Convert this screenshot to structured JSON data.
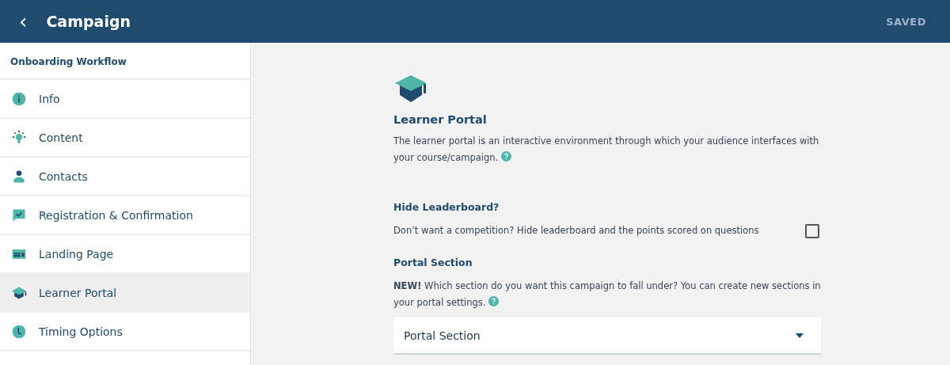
{
  "header": {
    "back_icon": "‹",
    "title": "Campaign",
    "status": "SAVED"
  },
  "sidebar": {
    "title": "Onboarding Workflow",
    "items": [
      {
        "label": "Info",
        "kind": "info",
        "selected": false
      },
      {
        "label": "Content",
        "kind": "bulb",
        "selected": false
      },
      {
        "label": "Contacts",
        "kind": "person",
        "selected": false
      },
      {
        "label": "Registration & Confirmation",
        "kind": "chat",
        "selected": false
      },
      {
        "label": "Landing Page",
        "kind": "page",
        "selected": false
      },
      {
        "label": "Learner Portal",
        "kind": "cap",
        "selected": true
      },
      {
        "label": "Timing Options",
        "kind": "clock",
        "selected": false
      }
    ]
  },
  "main": {
    "heading": "Learner Portal",
    "description": "The learner portal is an interactive environment through which your audience interfaces with your course/campaign.",
    "hide_leaderboard": {
      "heading": "Hide Leaderboard?",
      "label": "Don’t want a competition? Hide leaderboard and the points scored on questions",
      "checked": false
    },
    "portal_section": {
      "heading": "Portal Section",
      "description": "**NEW!** Which section do you want this campaign to fall under? You can create new sections in your portal settings.",
      "select_value": "Portal Section"
    }
  }
}
